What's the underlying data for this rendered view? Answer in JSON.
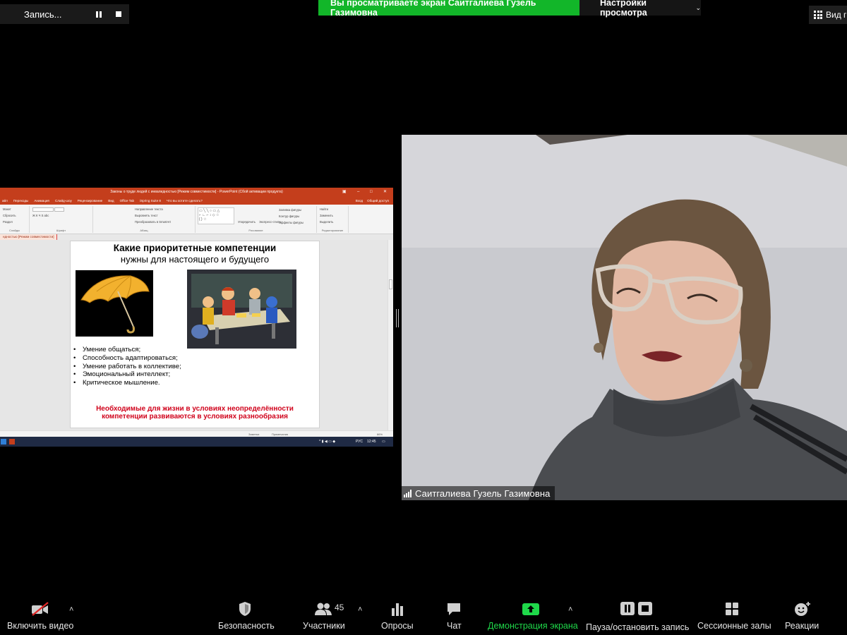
{
  "recording": {
    "label": "Запись...",
    "pause_icon": "pause-icon",
    "stop_icon": "stop-icon"
  },
  "share_banner": {
    "text": "Вы просматриваете экран Саитгалиева Гузель Газимовна",
    "color": "#12b629"
  },
  "view_options": {
    "label": "Настройки просмотра",
    "icon": "chevron-down-icon"
  },
  "view_switch": {
    "label": "Вид г",
    "icon": "grid-icon"
  },
  "powerpoint": {
    "window_title": "Законы о труде людей с инвалидностью [Режим совместимости] - PowerPoint (Сбой активации продукта)",
    "tabs": [
      "айл",
      "Переходы",
      "Анимация",
      "Слайд-шоу",
      "Рецензирование",
      "Вид",
      "Office Tab",
      "iSpring Suite 8",
      "Что вы хотите сделать?"
    ],
    "tabs_right": [
      "Вход",
      "Общий доступ"
    ],
    "ribbon": {
      "slides_items": [
        "Макет",
        "Сбросить",
        "Раздел"
      ],
      "slides_caption": "Слайды",
      "font_caption": "Шрифт",
      "paragraph_items": [
        "Направление текста",
        "Выровнять текст",
        "Преобразовать в SmartArt"
      ],
      "paragraph_caption": "Абзац",
      "drawing_items": [
        "Упорядочить",
        "Экспресс-стили",
        "Заливка фигуры",
        "Контур фигуры",
        "Эффекты фигуры"
      ],
      "drawing_caption": "Рисование",
      "editing_items": [
        "Найти",
        "Заменить",
        "Выделить"
      ],
      "editing_caption": "Редактирование"
    },
    "doc_tab": "ндностью [Режим совместимости]",
    "slide": {
      "title": "Какие приоритетные компетенции",
      "subtitle": "нужны для настоящего и будущего",
      "bullets": [
        "Умение общаться;",
        "Способность адаптироваться;",
        "Умение работать в коллективе;",
        "Эмоциональный интеллект;",
        "Критическое мышление."
      ],
      "footer_line1": "Необходимые для жизни в условиях неопределённости",
      "footer_line2": "компетенции развиваются в условиях разнообразия"
    },
    "status": {
      "notes": "Заметки",
      "comments": "Примечания",
      "zoom": "86%"
    },
    "taskbar": {
      "lang": "РУС",
      "time": "12:45"
    }
  },
  "video": {
    "participant_name": "Саитгалиева Гузель Газимовна",
    "signal_icon": "signal-strength-icon"
  },
  "toolbar": {
    "video_label": "Включить видео",
    "security_label": "Безопасность",
    "participants_label": "Участники",
    "participants_count": "45",
    "polls_label": "Опросы",
    "chat_label": "Чат",
    "share_label": "Демонстрация экрана",
    "record_label": "Пауза/остановить запись",
    "breakout_label": "Сессионные залы",
    "reactions_label": "Реакции",
    "accent_green": "#1fd84a"
  }
}
